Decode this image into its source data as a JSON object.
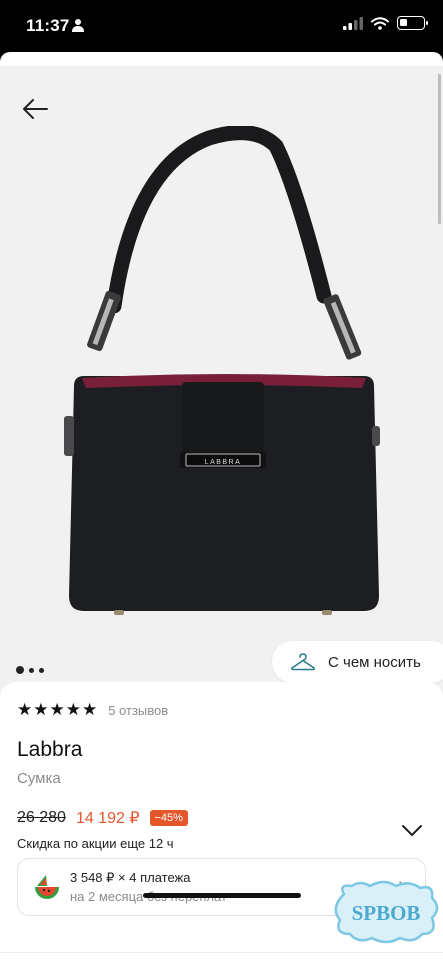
{
  "status_bar": {
    "time": "11:37",
    "battery_level": 0.3
  },
  "product": {
    "rating_stars": "★★★★★",
    "reviews": "5 отзывов",
    "brand": "Labbra",
    "type": "Сумка",
    "old_price": "26 280",
    "new_price": "14 192 ₽",
    "discount": "−45%",
    "promo": "Скидка по акции еще 12 ч",
    "logo_text": "LABBRA"
  },
  "gallery": {
    "image_count": 3,
    "active_index": 0
  },
  "wear_button": {
    "label": "С чем носить"
  },
  "installment": {
    "title": "3 548 ₽ × 4 платежа",
    "subtitle": "на 2 месяца без переплат"
  },
  "watermark": {
    "text": "SPBOB"
  },
  "icons": {
    "back": "arrow-left-icon",
    "hanger": "hanger-icon",
    "chevron_down": "chevron-down-icon",
    "chevron_right": "chevron-right-icon",
    "installment": "watermelon-icon"
  },
  "colors": {
    "accent": "#e5572b",
    "text": "#111111",
    "muted": "#8b8b8b"
  }
}
